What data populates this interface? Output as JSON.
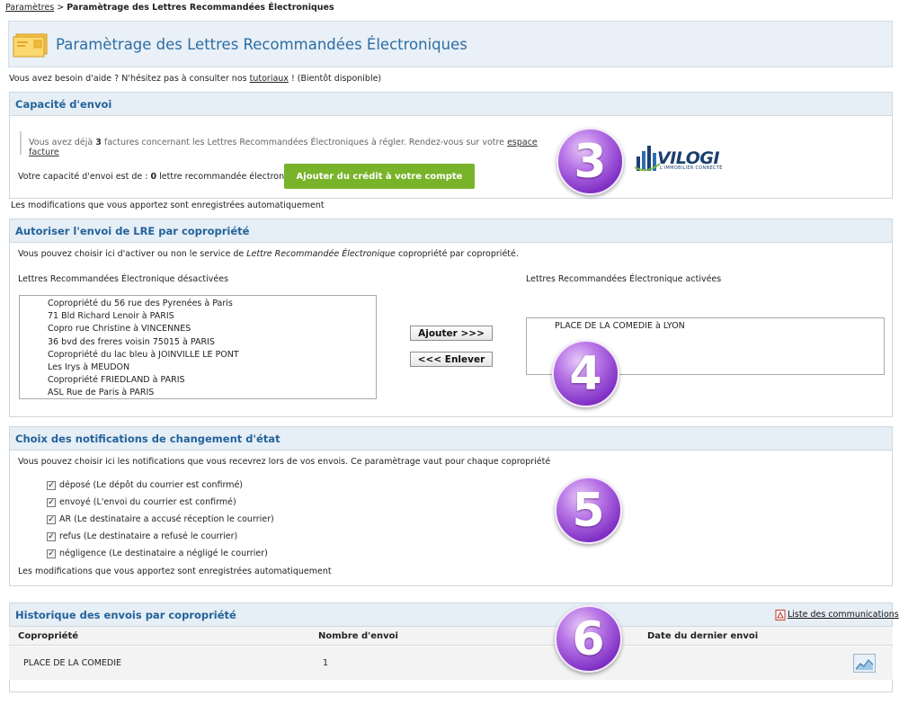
{
  "breadcrumb": {
    "parent": "Paramètres",
    "separator": ">",
    "current": "Paramètrage des Lettres Recommandées Électroniques"
  },
  "page": {
    "title": "Paramètrage des Lettres Recommandées Électroniques",
    "help_prefix": "Vous avez besoin d'aide ? N'hésitez pas à consulter nos",
    "help_link": "tutoriaux",
    "help_suffix": "! (Bientôt disponible)"
  },
  "capacity": {
    "title": "Capacité d'envoi",
    "notice_prefix": "Vous avez déjà",
    "invoice_count": "3",
    "notice_middle": "factures concernant les Lettres Recommandées Électroniques à régler. Rendez-vous sur votre",
    "notice_link": "espace facture",
    "capacity_prefix": "Votre capacité d'envoi est de :",
    "capacity_value": "0",
    "capacity_suffix": "lettre recommandée électronique.",
    "button": "Ajouter du crédit à votre compte",
    "auto_save": "Les modifications que vous apportez sont enregistrées automatiquement"
  },
  "logo": {
    "text": "VILOGI",
    "sub": "L'IMMOBILIER CONNECTÉ",
    "color": "#1c3f70"
  },
  "authorize": {
    "title": "Autoriser l'envoi de LRE par copropriété",
    "intro_prefix": "Vous pouvez choisir ici d'activer ou non le service de",
    "intro_italic": "Lettre Recommandée Électronique",
    "intro_suffix": "copropriété par copropriété.",
    "disabled_label": "Lettres Recommandées Électronique désactivées",
    "enabled_label": "Lettres Recommandées Électronique activées",
    "disabled_items": [
      "Copropriété du 56 rue des Pyrenées à Paris",
      "71 Bld Richard Lenoir à PARIS",
      "Copro rue Christine à VINCENNES",
      "36 bvd des freres voisin 75015 à PARIS",
      "Copropriété du lac bleu à JOINVILLE LE PONT",
      "Les Irys à MEUDON",
      "Copropriété FRIEDLAND à PARIS",
      "ASL Rue de Paris à PARIS"
    ],
    "enabled_items": [
      "PLACE DE LA COMEDIE à LYON"
    ],
    "add_button": "Ajouter >>>",
    "remove_button": "<<< Enlever"
  },
  "notifications": {
    "title": "Choix des notifications de changement d'état",
    "intro": "Vous pouvez choisir ici les notifications que vous recevrez lors de vos envois. Ce paramètrage vaut pour chaque copropriété",
    "options": [
      {
        "label": "déposé (Le dépôt du courrier est confirmé)",
        "checked": true
      },
      {
        "label": "envoyé (L'envoi du courrier est confirmé)",
        "checked": true
      },
      {
        "label": "AR (Le destinataire a accusé réception le courrier)",
        "checked": true
      },
      {
        "label": "refus (Le destinataire a refusé le courrier)",
        "checked": true
      },
      {
        "label": "négligence (Le destinataire a négligé le courrier)",
        "checked": true
      }
    ],
    "auto_save": "Les modifications que vous apportez sont enregistrées automatiquement"
  },
  "history": {
    "title": "Historique des envois par copropriété",
    "link": "Liste des communications",
    "columns": [
      "Copropriété",
      "Nombre d'envoi",
      "Date du dernier envoi"
    ],
    "rows": [
      {
        "copro": "PLACE DE LA COMEDIE",
        "count": "1",
        "last": ""
      }
    ]
  },
  "badges": [
    "3",
    "4",
    "5",
    "6"
  ],
  "colors": {
    "accent": "#24639a",
    "button_green": "#79b32a",
    "badge_purple": "#8a3fd0"
  }
}
